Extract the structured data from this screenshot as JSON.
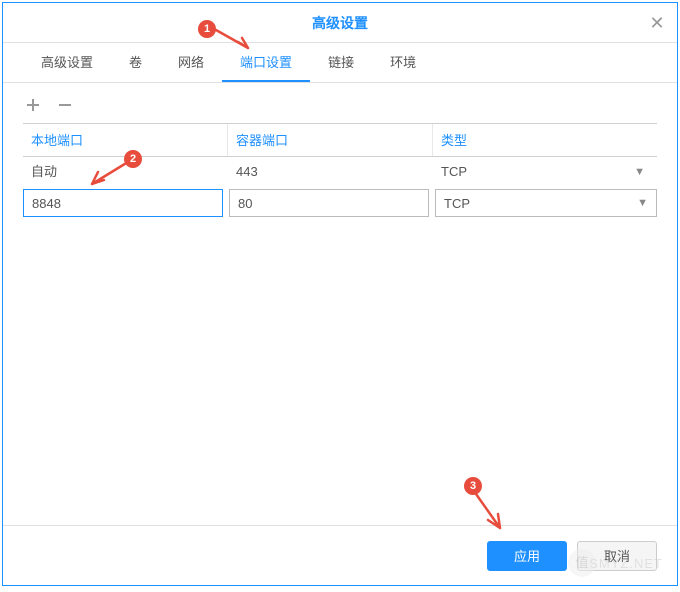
{
  "dialog": {
    "title": "高级设置"
  },
  "tabs": [
    "高级设置",
    "卷",
    "网络",
    "端口设置",
    "链接",
    "环境"
  ],
  "active_tab_index": 3,
  "columns": {
    "local": "本地端口",
    "container": "容器端口",
    "type": "类型"
  },
  "rows": [
    {
      "local": "自动",
      "container": "443",
      "type": "TCP"
    },
    {
      "local": "8848",
      "container": "80",
      "type": "TCP"
    }
  ],
  "buttons": {
    "apply": "应用",
    "cancel": "取消"
  },
  "annotations": {
    "b1": "1",
    "b2": "2",
    "b3": "3"
  },
  "watermark": "SMYZ.NET",
  "watermark_badge": "值"
}
